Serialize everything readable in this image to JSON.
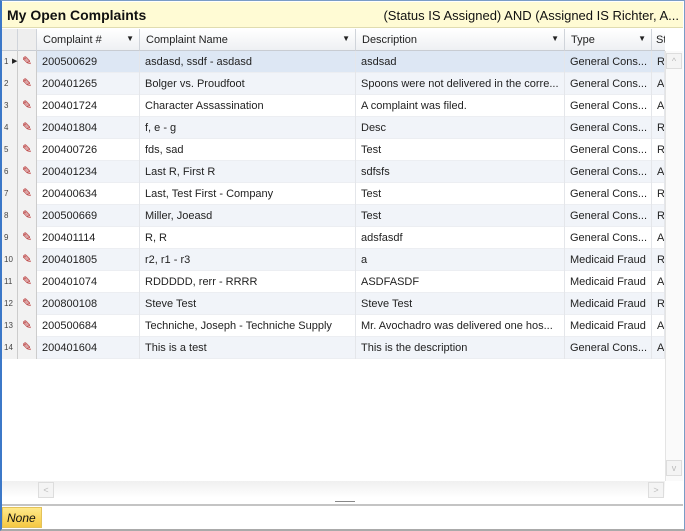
{
  "title": "My Open Complaints",
  "filter": "(Status IS Assigned) AND (Assigned IS Richter, A...",
  "columns": [
    "Complaint #",
    "Complaint Name",
    "Description",
    "Type",
    "Status"
  ],
  "rows": [
    {
      "n": "1",
      "id": "200500629",
      "name": "asdasd, ssdf - asdasd",
      "desc": "asdsad",
      "type": "General Cons...",
      "status": "R"
    },
    {
      "n": "2",
      "id": "200401265",
      "name": "Bolger vs. Proudfoot",
      "desc": "Spoons were not delivered in the corre...",
      "type": "General Cons...",
      "status": "A"
    },
    {
      "n": "3",
      "id": "200401724",
      "name": "Character Assassination",
      "desc": "A complaint was filed.",
      "type": "General Cons...",
      "status": "A"
    },
    {
      "n": "4",
      "id": "200401804",
      "name": "f, e - g",
      "desc": "Desc",
      "type": "General Cons...",
      "status": "R"
    },
    {
      "n": "5",
      "id": "200400726",
      "name": "fds, sad",
      "desc": "Test",
      "type": "General Cons...",
      "status": "R"
    },
    {
      "n": "6",
      "id": "200401234",
      "name": "Last R, First R",
      "desc": "sdfsfs",
      "type": "General Cons...",
      "status": "A"
    },
    {
      "n": "7",
      "id": "200400634",
      "name": "Last, Test First - Company",
      "desc": "Test",
      "type": "General Cons...",
      "status": "R"
    },
    {
      "n": "8",
      "id": "200500669",
      "name": "Miller, Joeasd",
      "desc": "Test",
      "type": "General Cons...",
      "status": "R"
    },
    {
      "n": "9",
      "id": "200401114",
      "name": "R, R",
      "desc": "adsfasdf",
      "type": "General Cons...",
      "status": "A"
    },
    {
      "n": "10",
      "id": "200401805",
      "name": "r2, r1 - r3",
      "desc": "a",
      "type": "Medicaid Fraud",
      "status": "R"
    },
    {
      "n": "11",
      "id": "200401074",
      "name": "RDDDDD, rerr - RRRR",
      "desc": "ASDFASDF",
      "type": "Medicaid Fraud",
      "status": "A"
    },
    {
      "n": "12",
      "id": "200800108",
      "name": "Steve Test",
      "desc": "Steve Test",
      "type": "Medicaid Fraud",
      "status": "R"
    },
    {
      "n": "13",
      "id": "200500684",
      "name": "Techniche, Joseph - Techniche Supply",
      "desc": "Mr. Avochadro was delivered one hos...",
      "type": "Medicaid Fraud",
      "status": "A"
    },
    {
      "n": "14",
      "id": "200401604",
      "name": "This is a test",
      "desc": "This is the description",
      "type": "General Cons...",
      "status": "A"
    }
  ],
  "selected_row": 0,
  "footer": {
    "none_label": "None"
  },
  "icons": {
    "row_edit": "pencil-icon",
    "sort": "chevron-down-icon"
  }
}
